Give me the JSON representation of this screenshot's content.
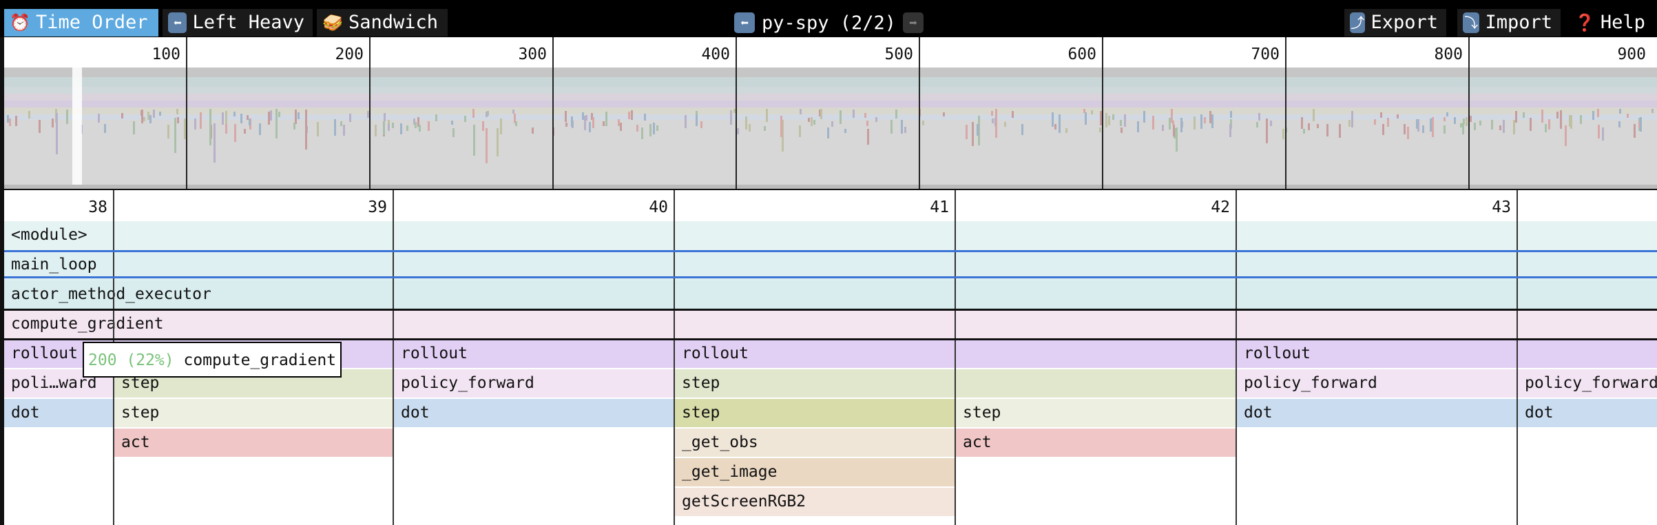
{
  "toolbar": {
    "time_order": {
      "label": "Time Order",
      "icon": "alarm-clock-icon"
    },
    "left_heavy": {
      "label": "Left Heavy",
      "icon": "left-arrow-icon"
    },
    "sandwich": {
      "label": "Sandwich",
      "icon": "sandwich-icon"
    },
    "title": "py-spy (2/2)",
    "prev_profile": {
      "icon": "left-arrow-icon"
    },
    "next_profile": {
      "icon": "right-arrow-icon"
    },
    "export": {
      "label": "Export",
      "icon": "export-icon"
    },
    "import": {
      "label": "Import",
      "icon": "import-icon"
    },
    "help": {
      "label": "Help",
      "icon": "question-mark-icon"
    },
    "accent_color": "#5da9e0"
  },
  "minimap": {
    "axis_labels": [
      "100",
      "200",
      "300",
      "400",
      "500",
      "600",
      "700",
      "800",
      "900"
    ]
  },
  "flamechart": {
    "axis_labels": [
      "38",
      "39",
      "40",
      "41",
      "42",
      "43"
    ],
    "rows": [
      {
        "frames": [
          {
            "name": "<module>",
            "color": "#e6f3f3"
          }
        ]
      },
      {
        "frames": [
          {
            "name": "main_loop",
            "color": "#def0f2"
          }
        ]
      },
      {
        "frames": [
          {
            "name": "actor_method_executor",
            "color": "#d9edef"
          }
        ]
      },
      {
        "frames": [
          {
            "name": "compute_gradient",
            "color": "#f4e6f1"
          }
        ]
      },
      {
        "frames": [
          {
            "name": "rollout",
            "color": "#e2d0f4"
          },
          {
            "name": "rollout",
            "color": "#e2d0f4"
          },
          {
            "name": "rollout",
            "color": "#e2d0f4"
          },
          {
            "name": "",
            "color": "#e2d0f4"
          },
          {
            "name": "rollout",
            "color": "#e2d0f4"
          },
          {
            "name": "",
            "color": "#e2d0f4"
          }
        ]
      },
      {
        "frames": [
          {
            "name": "poli…ward",
            "color": "#f2e4f3"
          },
          {
            "name": "step",
            "color": "#e1e7cd"
          },
          {
            "name": "policy_forward",
            "color": "#f2e4f3"
          },
          {
            "name": "step",
            "color": "#e1e7cd"
          },
          {
            "name": "",
            "color": "#e1e7cd"
          },
          {
            "name": "policy_forward",
            "color": "#f2e4f3"
          },
          {
            "name": "policy_forward",
            "color": "#f2e4f3"
          }
        ]
      },
      {
        "frames": [
          {
            "name": "dot",
            "color": "#c9dcf0"
          },
          {
            "name": "step",
            "color": "#edf0e0"
          },
          {
            "name": "dot",
            "color": "#c9dcf0"
          },
          {
            "name": "step",
            "color": "#d7dca8"
          },
          {
            "name": "step",
            "color": "#edf0e0"
          },
          {
            "name": "dot",
            "color": "#c9dcf0"
          },
          {
            "name": "dot",
            "color": "#c9dcf0"
          }
        ]
      },
      {
        "frames": [
          {
            "name": "act",
            "color": "#f0c6c6"
          },
          {
            "name": "_get_obs",
            "color": "#f0e6d8"
          },
          {
            "name": "act",
            "color": "#f0c6c6"
          }
        ]
      },
      {
        "frames": [
          {
            "name": "_get_image",
            "color": "#ead8c2"
          }
        ]
      },
      {
        "frames": [
          {
            "name": "getScreenRGB2",
            "color": "#f3e4dc"
          }
        ]
      }
    ],
    "selection_color": "#3b74d6"
  },
  "tooltip": {
    "count": "200 (22%)",
    "name": "compute_gradient"
  }
}
